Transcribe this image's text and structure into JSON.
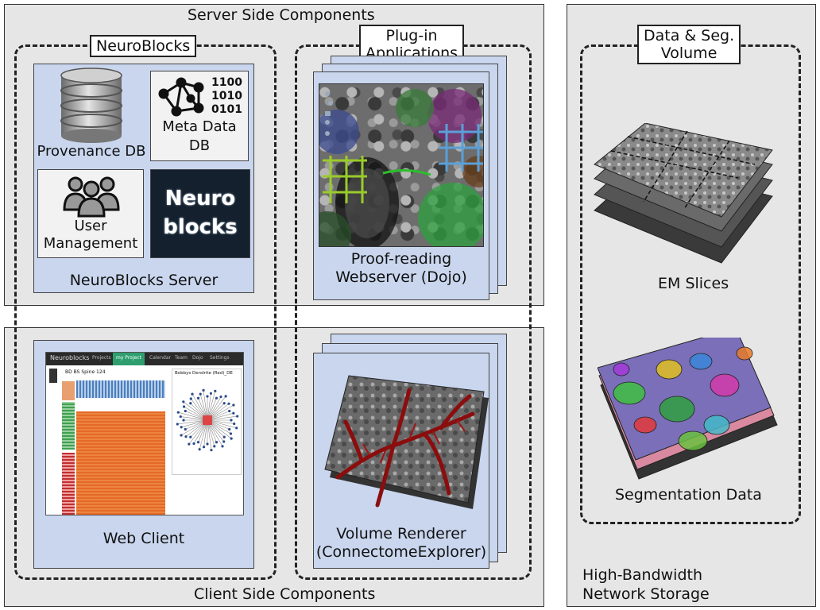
{
  "regions": {
    "server": "Server Side Components",
    "client": "Client Side Components",
    "storage": "High-Bandwidth\nNetwork Storage"
  },
  "groups": {
    "neuroblocks": "NeuroBlocks",
    "plugins": "Plug-in\nApplications",
    "data": "Data & Seg.\nVolume"
  },
  "neuroblocks_server": {
    "caption": "NeuroBlocks Server",
    "provenance_db": "Provenance DB",
    "binary_text": "1100\n1010\n0101",
    "metadata_db": "Meta Data\nDB",
    "user_management": "User\nManagement",
    "logo": "Neuro\nblocks"
  },
  "proofreading": {
    "caption": "Proof-reading\nWebserver (Dojo)"
  },
  "web_client": {
    "caption": "Web Client",
    "nav_brand": "Neuroblocks",
    "nav_items": [
      "Projects",
      "my Project",
      "Calendar",
      "Team",
      "Dojo",
      "Settings"
    ],
    "panel_left_title": "BD BS Spine 124",
    "panel_right_title": "Bobbys Dendrite (Red)_DE"
  },
  "volume_renderer": {
    "caption": "Volume Renderer\n(ConnectomeExplorer)"
  },
  "storage_items": {
    "em_slices": "EM Slices",
    "segmentation": "Segmentation Data"
  },
  "colors": {
    "region_bg": "#e6e6e6",
    "panel_bg": "#c9d6ee",
    "logo_bg": "#14202e",
    "vessel_red": "#8b0d0d",
    "nav_green": "#2e9e6e"
  }
}
